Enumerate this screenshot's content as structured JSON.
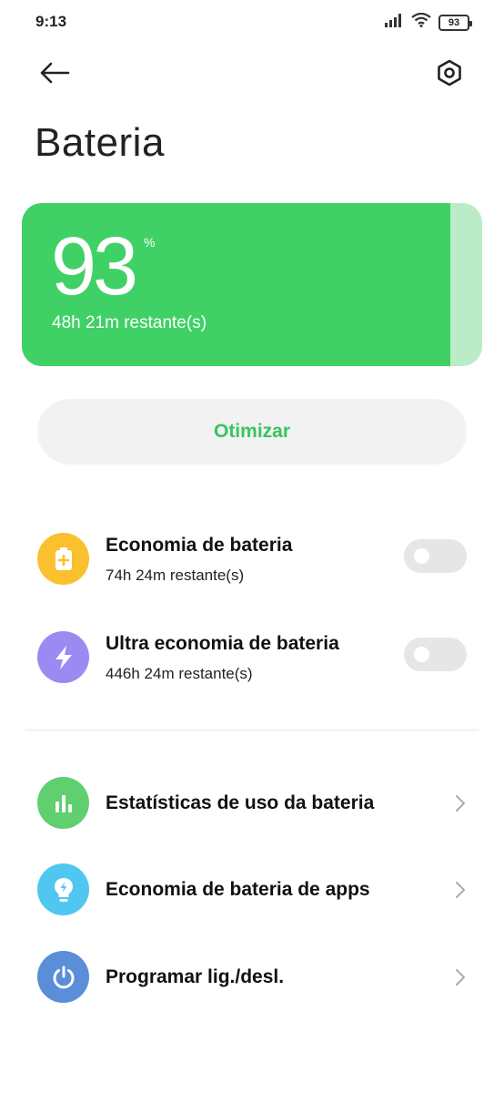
{
  "status_bar": {
    "time": "9:13",
    "battery_level": "93",
    "icons": [
      "signal-icon",
      "wifi-icon",
      "battery-icon"
    ]
  },
  "header": {
    "title": "Bateria",
    "back_icon": "arrow-left-icon",
    "settings_icon": "settings-hexagon-icon"
  },
  "battery_card": {
    "percent": "93",
    "percent_sign": "%",
    "remaining": "48h 21m restante(s)",
    "level_fraction": 0.93,
    "fill_color": "#40d166",
    "empty_color": "#b9ecc7"
  },
  "optimize": {
    "label": "Otimizar",
    "color": "#3ac45e"
  },
  "modes": [
    {
      "title": "Economia de bateria",
      "subtitle": "74h 24m restante(s)",
      "icon": "battery-plus-icon",
      "icon_color": "#fbc02d",
      "enabled": false
    },
    {
      "title": "Ultra economia de bateria",
      "subtitle": "446h 24m restante(s)",
      "icon": "lightning-icon",
      "icon_color": "#9a8bf2",
      "enabled": false
    }
  ],
  "links": [
    {
      "title": "Estatísticas de uso da bateria",
      "icon": "bar-chart-icon",
      "icon_color": "#5fcf6f"
    },
    {
      "title": "Economia de bateria de apps",
      "icon": "lightbulb-bolt-icon",
      "icon_color": "#4fc7f0"
    },
    {
      "title": "Programar lig./desl.",
      "icon": "power-icon",
      "icon_color": "#5b8ed8"
    }
  ]
}
